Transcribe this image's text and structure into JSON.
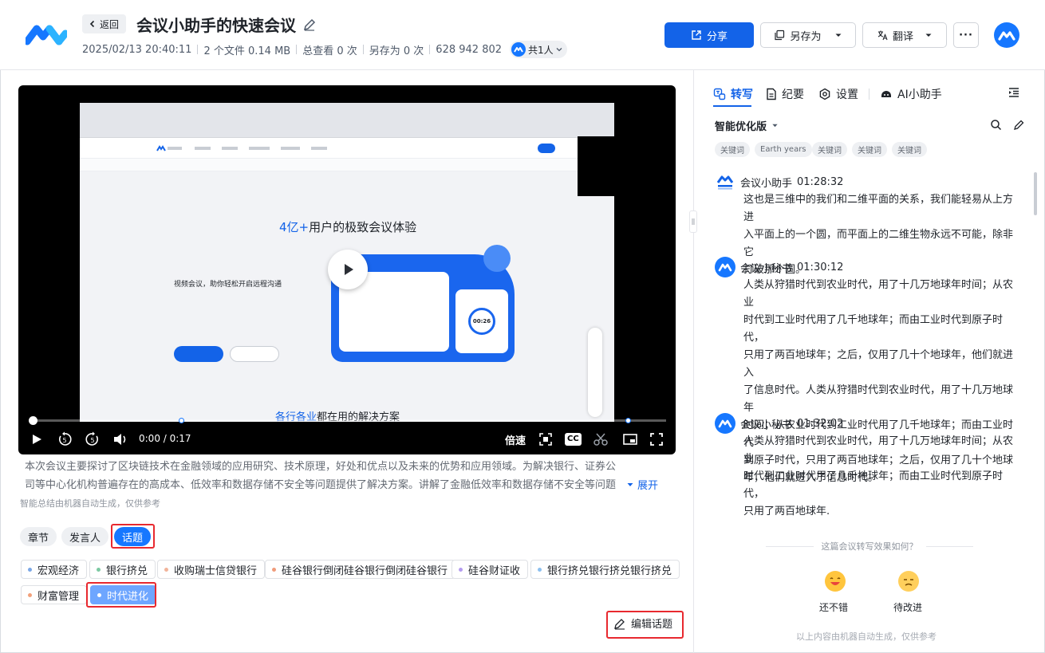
{
  "header": {
    "back_label": "返回",
    "title": "会议小助手的快速会议",
    "date": "2025/02/13 20:40:11",
    "files": "2 个文件 0.14 MB",
    "views": "总查看 0 次",
    "saves": "另存为 0 次",
    "meeting_id": "628 942 802",
    "participants": "共1人",
    "share_label": "分享",
    "save_as_label": "另存为",
    "translate_label": "翻译",
    "more_label": "···"
  },
  "video": {
    "time": "0:00 / 0:17",
    "speed_label": "倍速",
    "cc_label": "CC",
    "rewind_label": "5",
    "forward_label": "5",
    "progress": 0,
    "screen": {
      "hero_num": "4亿+",
      "hero_text": "用户的极致会议体验",
      "hero_left": "视频会议，助你轻松开启远程沟通",
      "timer": "00:26",
      "footer_hl": "各行各业",
      "footer_text": "都在用的解决方案"
    }
  },
  "summary": {
    "text": "本次会议主要探讨了区块链技术在金融领域的应用研究、技术原理，好处和优点以及未来的优势和应用领域。为解决银行、证券公司等中心化机构普遍存在的高成本、低效率和数据存储不安全等问题提供了解决方案。讲解了金融低效率和数据存储不安全等问题提...",
    "expand_label": "展开",
    "ai_note": "智能总结由机器自动生成，仅供参考"
  },
  "segments": [
    "章节",
    "发言人",
    "话题"
  ],
  "topics": [
    {
      "label": "宏观经济",
      "color": "#7aa7e6"
    },
    {
      "label": "银行挤兑",
      "color": "#7cc9a2"
    },
    {
      "label": "收购瑞士信贷银行",
      "color": "#f2b49a"
    },
    {
      "label": "硅谷银行倒闭硅谷银行倒闭硅谷银行",
      "color": "#f09b7a"
    },
    {
      "label": "硅谷财证收",
      "color": "#b49cf0"
    },
    {
      "label": "银行挤兑银行挤兑银行挤兑",
      "color": "#8cc0ef"
    },
    {
      "label": "财富管理",
      "color": "#f2a07a"
    },
    {
      "label": "时代进化",
      "color": "#ffffff"
    }
  ],
  "edit_topic_label": "编辑话题",
  "right": {
    "tabs": [
      "转写",
      "纪要",
      "设置",
      "AI小助手"
    ],
    "version": "智能优化版",
    "keywords": [
      "关键词",
      "Earth years",
      "关键词",
      "关键词",
      "关键词"
    ],
    "entries": [
      {
        "speaker": "会议小助手",
        "time": "01:28:32",
        "lines": [
          "这也是三维中的我们和二维平面的关系，我们能轻易从上方进",
          "入平面上的一个圆，而平面上的二维生物永远不可能，除非它",
          "打破那个圆。"
        ]
      },
      {
        "speaker": "会议小秘书",
        "time": "01:30:12",
        "lines": [
          "人类从狩猎时代到农业时代，用了十几万地球年时间；从农业",
          "时代到工业时代用了几千地球年；而由工业时代到原子时代，",
          "只用了两百地球年；之后，仅用了几十个地球年，他们就进入",
          "了信息时代。人类从狩猎时代到农业时代，用了十几万地球年",
          "时间；从农业时代到工业时代用了几千地球年；而由工业时代",
          "到原子时代，只用了两百地球年；之后，仅用了几十个地球",
          "年，他们就进入了信息时代。"
        ]
      },
      {
        "speaker": "会议小秘书",
        "time": "01:32:02",
        "lines": [
          "人类从狩猎时代到农业时代，用了十几万地球年时间；从农业",
          "时代到工业时代用了几千地球年；而由工业时代到原子时代，",
          "只用了两百地球年."
        ]
      }
    ],
    "feedback_title": "这篇会议转写效果如何？",
    "good_label": "还不错",
    "improve_label": "待改进",
    "footer_note": "以上内容由机器自动生成，仅供参考"
  }
}
